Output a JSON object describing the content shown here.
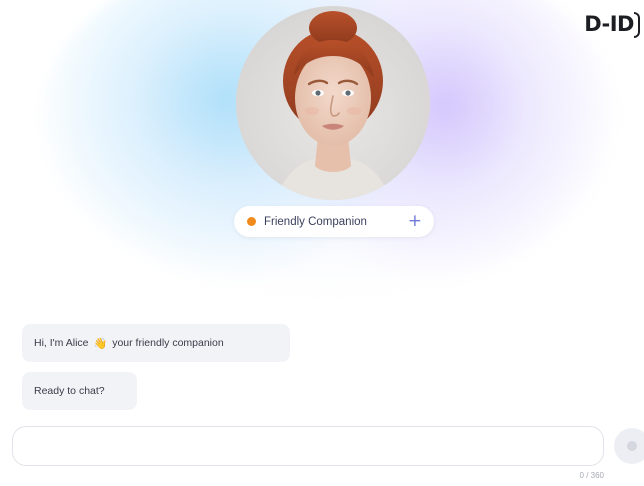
{
  "brand": {
    "logo_text": "D-ID"
  },
  "persona": {
    "name": "Friendly Companion",
    "dot_color": "#f08a1c",
    "add_icon": "plus-icon"
  },
  "avatar": {
    "description_icon": "avatar-portrait"
  },
  "messages": [
    {
      "text_before": "Hi, I'm Alice",
      "emoji": "👋",
      "text_after": "your friendly companion"
    },
    {
      "text": "Ready to chat?"
    }
  ],
  "input": {
    "value": "",
    "placeholder": "",
    "char_count": "0 / 360"
  },
  "send": {
    "icon": "send-icon"
  },
  "colors": {
    "accent": "#6f7ad8",
    "glow_blue": "#78cef6",
    "glow_purple": "#baa0fc",
    "bubble": "#f2f3f6"
  }
}
